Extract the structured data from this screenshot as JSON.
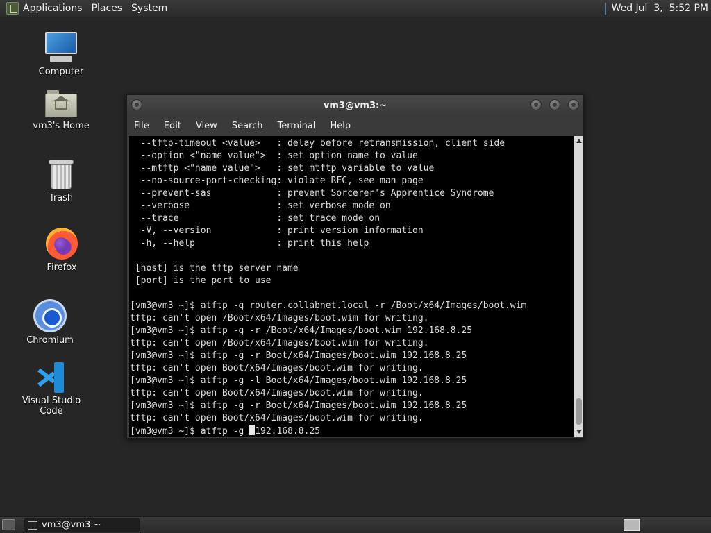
{
  "top_panel": {
    "menus": [
      "Applications",
      "Places",
      "System"
    ],
    "clock": "Wed Jul  3,  5:52 PM"
  },
  "desktop_icons": [
    {
      "label": "Computer",
      "icon": "computer-icon"
    },
    {
      "label": "vm3's Home",
      "icon": "home-folder-icon"
    },
    {
      "label": "Trash",
      "icon": "trash-icon"
    },
    {
      "label": "Firefox",
      "icon": "firefox-icon"
    },
    {
      "label": "Chromium",
      "icon": "chromium-icon"
    },
    {
      "label": "Visual Studio Code",
      "icon": "vscode-icon"
    }
  ],
  "terminal": {
    "title": "vm3@vm3:~",
    "menus": [
      "File",
      "Edit",
      "View",
      "Search",
      "Terminal",
      "Help"
    ],
    "lines": [
      "  --tftp-timeout <value>   : delay before retransmission, client side",
      "  --option <\"name value\">  : set option name to value",
      "  --mtftp <\"name value\">   : set mtftp variable to value",
      "  --no-source-port-checking: violate RFC, see man page",
      "  --prevent-sas            : prevent Sorcerer's Apprentice Syndrome",
      "  --verbose                : set verbose mode on",
      "  --trace                  : set trace mode on",
      "  -V, --version            : print version information",
      "  -h, --help               : print this help",
      "",
      " [host] is the tftp server name",
      " [port] is the port to use",
      "",
      "[vm3@vm3 ~]$ atftp -g router.collabnet.local -r /Boot/x64/Images/boot.wim",
      "tftp: can't open /Boot/x64/Images/boot.wim for writing.",
      "[vm3@vm3 ~]$ atftp -g -r /Boot/x64/Images/boot.wim 192.168.8.25",
      "tftp: can't open /Boot/x64/Images/boot.wim for writing.",
      "[vm3@vm3 ~]$ atftp -g -r Boot/x64/Images/boot.wim 192.168.8.25",
      "tftp: can't open Boot/x64/Images/boot.wim for writing.",
      "[vm3@vm3 ~]$ atftp -g -l Boot/x64/Images/boot.wim 192.168.8.25",
      "tftp: can't open Boot/x64/Images/boot.wim for writing.",
      "[vm3@vm3 ~]$ atftp -g -r Boot/x64/Images/boot.wim 192.168.8.25",
      "tftp: can't open Boot/x64/Images/boot.wim for writing."
    ],
    "prompt_before_cursor": "[vm3@vm3 ~]$ atftp -g ",
    "prompt_after_cursor": "192.168.8.25"
  },
  "taskbar": {
    "window_button": "vm3@vm3:~"
  }
}
